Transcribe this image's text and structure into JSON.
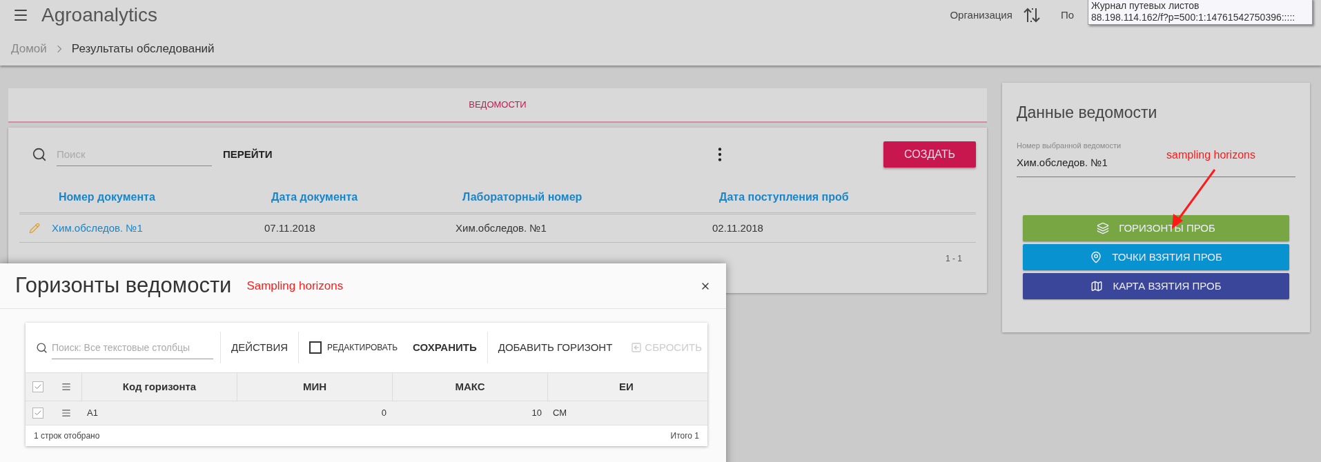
{
  "app": {
    "title": "Agroanalytics",
    "nav": [
      {
        "label": "Организация"
      },
      {
        "label": "По"
      }
    ]
  },
  "tooltip": {
    "title": "Журнал путевых листов",
    "url": "88.198.114.162/f?p=500:1:14761542750396:::::"
  },
  "breadcrumbs": [
    {
      "label": "Домой"
    },
    {
      "label": "Результаты обследований"
    }
  ],
  "tabs": [
    {
      "label": "ВЕДОМОСТИ",
      "selected": true
    }
  ],
  "toolbar": {
    "search_placeholder": "Поиск",
    "go_button": "ПЕРЕЙТИ",
    "create_button": "СОЗДАТЬ"
  },
  "table": {
    "columns": [
      "Номер документа",
      "Дата документа",
      "Лабораторный номер",
      "Дата поступления проб"
    ],
    "rows": [
      {
        "cells": [
          "Хим.обследов. №1",
          "07.11.2018",
          "Хим.обследов. №1",
          "02.11.2018"
        ]
      }
    ],
    "pagination": "1 - 1"
  },
  "details_panel": {
    "title": "Данные ведомости",
    "field_label": "Номер выбранной ведомости",
    "field_value": "Хим.обследов. №1",
    "annotation": "sampling horizons",
    "buttons": [
      {
        "label": "ГОРИЗОНТЫ ПРОБ",
        "kind": "layers",
        "color": "#78a642"
      },
      {
        "label": "ТОЧКИ ВЗЯТИЯ ПРОБ",
        "kind": "pin",
        "color": "#0892d0"
      },
      {
        "label": "КАРТА ВЗЯТИЯ ПРОБ",
        "kind": "map",
        "color": "#3a4699"
      }
    ]
  },
  "modal": {
    "title": "Горизонты ведомости",
    "annotation": "Sampling horizons",
    "search_placeholder": "Поиск: Все текстовые столбцы",
    "actions_button": "ДЕЙСТВИЯ",
    "edit_toggle": {
      "label": "РЕДАКТИРОВАТЬ",
      "checked": false
    },
    "save_button": "СОХРАНИТЬ",
    "add_button": "ДОБАВИТЬ ГОРИЗОНТ",
    "reset_button": {
      "label": "СБРОСИТЬ",
      "disabled": true
    },
    "grid": {
      "select_all_checked": true,
      "columns": [
        "Код горизонта",
        "МИН",
        "МАКС",
        "ЕИ"
      ],
      "rows": [
        {
          "selected": true,
          "cells": [
            "A1",
            "0",
            "10",
            "СМ"
          ]
        }
      ],
      "selection_summary": "1 строк отобрано",
      "total": "Итого 1"
    }
  }
}
